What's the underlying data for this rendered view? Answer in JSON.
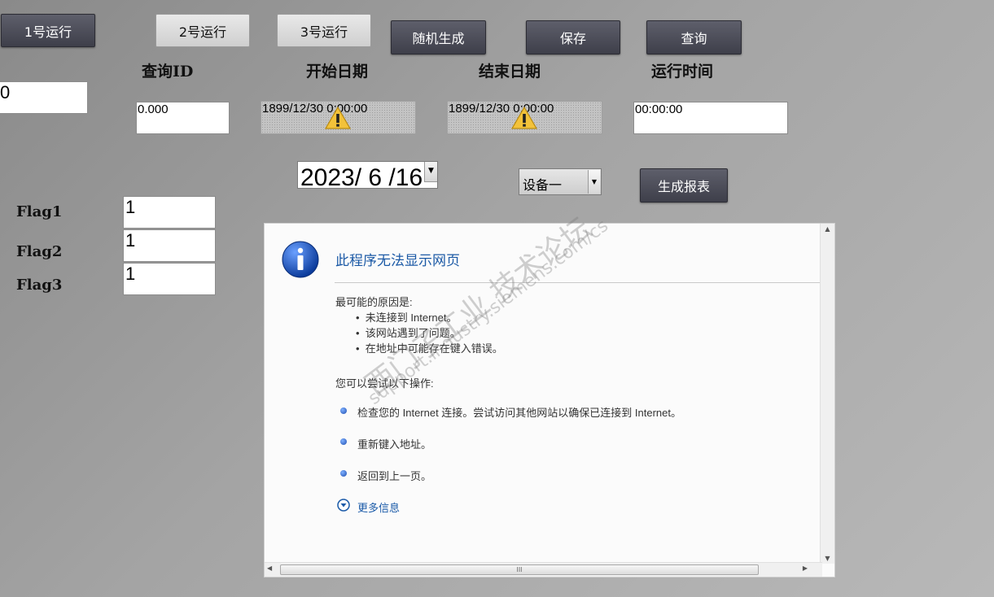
{
  "toolbar": {
    "run1": "1号运行",
    "run2": "2号运行",
    "run3": "3号运行",
    "random": "随机生成",
    "save": "保存",
    "query": "查询"
  },
  "headers": {
    "query_id": "查询ID",
    "start_date": "开始日期",
    "end_date": "结束日期",
    "run_time": "运行时间"
  },
  "fields": {
    "left_value": "0",
    "query_id": "0.000",
    "start_date": "1899/12/30 0:00:00",
    "end_date": "1899/12/30 0:00:00",
    "run_time": "00:00:00"
  },
  "date_picker": {
    "value": "2023/ 6 /16"
  },
  "device_select": {
    "value": "设备一"
  },
  "report_button": "生成报表",
  "flags": [
    {
      "label": "Flag1",
      "value": "1"
    },
    {
      "label": "Flag2",
      "value": "1"
    },
    {
      "label": "Flag3",
      "value": "1"
    }
  ],
  "browser": {
    "title": "此程序无法显示网页",
    "reasons_heading": "最可能的原因是:",
    "reasons": [
      "未连接到 Internet。",
      "该网站遇到了问题。",
      "在地址中可能存在键入错误。"
    ],
    "actions_heading": "您可以尝试以下操作:",
    "actions": [
      "检查您的 Internet 连接。尝试访问其他网站以确保已连接到 Internet。",
      "重新键入地址。",
      "返回到上一页。"
    ],
    "more_info": "更多信息",
    "hscroll_grip": "III"
  },
  "watermark": {
    "cn": "西门子工业 技术论坛",
    "url": "support.industry.siemens.com/cs"
  },
  "colors": {
    "dark_button": "#4a4b56",
    "title_blue": "#1c5aa6",
    "link_blue": "#1a5aa8"
  }
}
